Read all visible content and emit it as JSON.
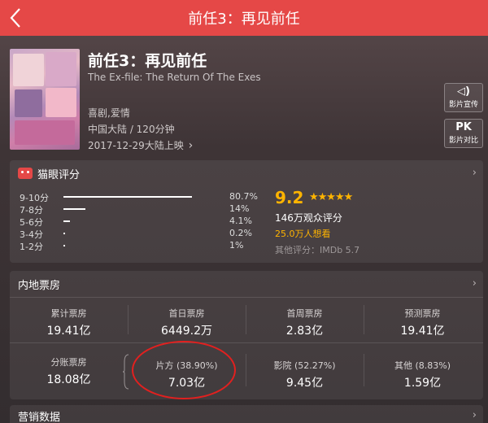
{
  "topbar": {
    "title": "前任3：再见前任"
  },
  "movie": {
    "title": "前任3：再见前任",
    "english_title": "The Ex-file: The Return Of The Exes",
    "genre": "喜剧,爱情",
    "region_duration": "中国大陆 / 120分钟",
    "release": "2017-12-29大陆上映",
    "release_chevron": "›"
  },
  "side_buttons": [
    {
      "icon": "◁)",
      "label": "影片宣传"
    },
    {
      "icon": "PK",
      "label": "影片对比"
    }
  ],
  "rating": {
    "header": "猫眼评分",
    "distribution": [
      {
        "label": "9-10分",
        "pct": "80.7%",
        "value": 80.7
      },
      {
        "label": "7-8分",
        "pct": "14%",
        "value": 14
      },
      {
        "label": "5-6分",
        "pct": "4.1%",
        "value": 4.1
      },
      {
        "label": "3-4分",
        "pct": "0.2%",
        "value": 0.2
      },
      {
        "label": "1-2分",
        "pct": "1%",
        "value": 1
      }
    ],
    "score": "9.2",
    "stars": "★★★★★",
    "star_value": 4.6,
    "count": "146万观众评分",
    "want": "25.0万人想看",
    "other": "其他评分：IMDb 5.7"
  },
  "boxoffice": {
    "header": "内地票房",
    "row1": [
      {
        "label": "累计票房",
        "value": "19.41亿"
      },
      {
        "label": "首日票房",
        "value": "6449.2万"
      },
      {
        "label": "首周票房",
        "value": "2.83亿"
      },
      {
        "label": "预测票房",
        "value": "19.41亿"
      }
    ],
    "row2": [
      {
        "label": "分账票房",
        "value": "18.08亿"
      },
      {
        "label": "片方 (38.90%)",
        "value": "7.03亿"
      },
      {
        "label": "影院 (52.27%)",
        "value": "9.45亿"
      },
      {
        "label": "其他 (8.83%)",
        "value": "1.59亿"
      }
    ]
  },
  "marketing": {
    "header": "营销数据"
  },
  "colors": {
    "topbar": "#e54847",
    "accent": "#ffb400",
    "annotation": "#e2201f"
  }
}
